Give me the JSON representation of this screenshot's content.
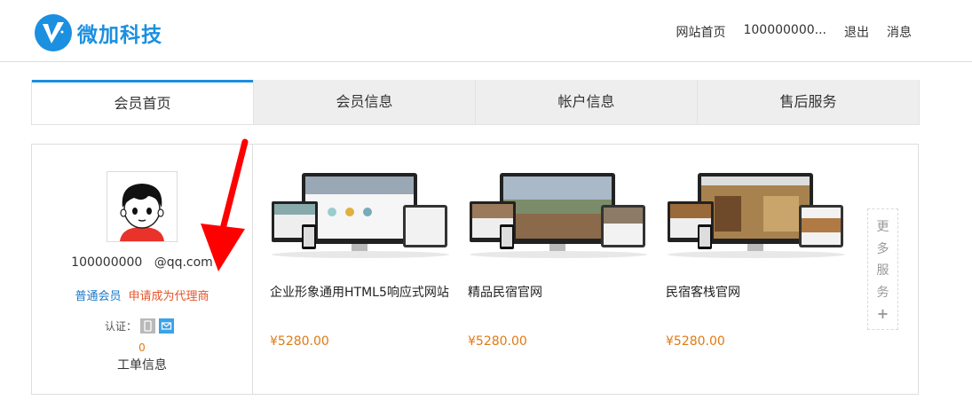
{
  "brand": {
    "name": "微加科技",
    "accent": "#1b8fe0"
  },
  "topnav": {
    "home": "网站首页",
    "account": "100000000...",
    "logout": "退出",
    "messages": "消息"
  },
  "tabs": [
    "会员首页",
    "会员信息",
    "帐户信息",
    "售后服务"
  ],
  "profile": {
    "account": "100000000   @qq.com",
    "member_level": "普通会员",
    "apply_agent": "申请成为代理商",
    "verify_label": "认证：",
    "ticket_count": "0",
    "ticket_label": "工单信息"
  },
  "products": [
    {
      "name": "企业形象通用HTML5响应式网站",
      "price": "¥5280.00"
    },
    {
      "name": "精品民宿官网",
      "price": "¥5280.00"
    },
    {
      "name": "民宿客栈官网",
      "price": "¥5280.00"
    }
  ],
  "more": {
    "chars": [
      "更",
      "多",
      "服",
      "务"
    ],
    "plus": "+"
  },
  "colors": {
    "price": "#e07a14",
    "agent_link": "#e8552a",
    "member_link": "#1b78c8",
    "annotation_arrow": "#ff0000"
  }
}
